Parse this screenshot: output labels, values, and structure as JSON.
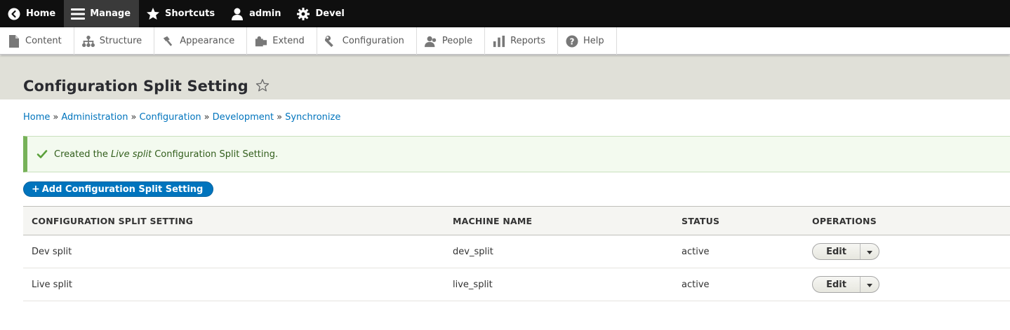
{
  "toolbar": {
    "items": [
      {
        "label": "Home",
        "icon": "chevron-left-circle-icon"
      },
      {
        "label": "Manage",
        "icon": "hamburger-icon"
      },
      {
        "label": "Shortcuts",
        "icon": "star-icon"
      },
      {
        "label": "admin",
        "icon": "user-icon"
      },
      {
        "label": "Devel",
        "icon": "gear-icon"
      }
    ]
  },
  "tray": {
    "items": [
      {
        "label": "Content",
        "icon": "file-icon"
      },
      {
        "label": "Structure",
        "icon": "sitemap-icon"
      },
      {
        "label": "Appearance",
        "icon": "paintbrush-icon"
      },
      {
        "label": "Extend",
        "icon": "puzzle-icon"
      },
      {
        "label": "Configuration",
        "icon": "wrench-icon"
      },
      {
        "label": "People",
        "icon": "people-icon"
      },
      {
        "label": "Reports",
        "icon": "bar-chart-icon"
      },
      {
        "label": "Help",
        "icon": "help-icon"
      }
    ]
  },
  "page": {
    "title": "Configuration Split Setting"
  },
  "breadcrumb": {
    "items": [
      "Home",
      "Administration",
      "Configuration",
      "Development",
      "Synchronize"
    ],
    "separator": "»"
  },
  "status": {
    "prefix": "Created the ",
    "emphasis": "Live split",
    "suffix": " Configuration Split Setting."
  },
  "actions": {
    "add_label": "Add Configuration Split Setting",
    "add_prefix": "+"
  },
  "table": {
    "headers": [
      "Configuration Split Setting",
      "Machine name",
      "Status",
      "Operations"
    ],
    "rows": [
      {
        "name": "Dev split",
        "machine": "dev_split",
        "status": "active",
        "op": "Edit"
      },
      {
        "name": "Live split",
        "machine": "live_split",
        "status": "active",
        "op": "Edit"
      }
    ]
  },
  "colors": {
    "toolbar_bg": "#0f0f0f",
    "link": "#0074bd",
    "primary_button": "#0074bd",
    "status_border": "#77b259",
    "status_bg": "#f3faef",
    "header_bg": "#e0e0d8"
  }
}
